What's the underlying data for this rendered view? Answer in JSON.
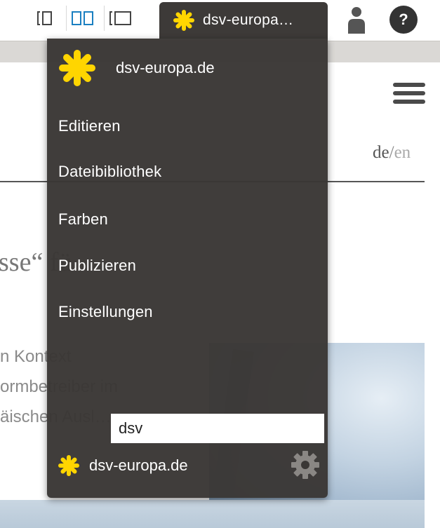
{
  "toolbar": {
    "layout_buttons": [
      {
        "name": "single-column-layout"
      },
      {
        "name": "two-column-layout",
        "active": true
      },
      {
        "name": "wide-layout"
      }
    ],
    "site_tab_label": "dsv-europa…",
    "accent_color": "#ffd500",
    "active_layout_color": "#1a7fc1",
    "help_label": "?"
  },
  "website": {
    "lang_primary": "de",
    "lang_separator": "/",
    "lang_secondary": "en",
    "headline_fragment": "sse“ fü",
    "body_lines": [
      "n Kontext",
      "ormbetreiber im",
      "äischen Ausl…"
    ]
  },
  "panel": {
    "site_title": "dsv-europa.de",
    "menu": [
      "Editieren",
      "Dateibibliothek",
      "Farben",
      "Publizieren",
      "Einstellungen"
    ],
    "search_value": "dsv",
    "result_site": "dsv-europa.de",
    "background_color": "#3a3735"
  }
}
